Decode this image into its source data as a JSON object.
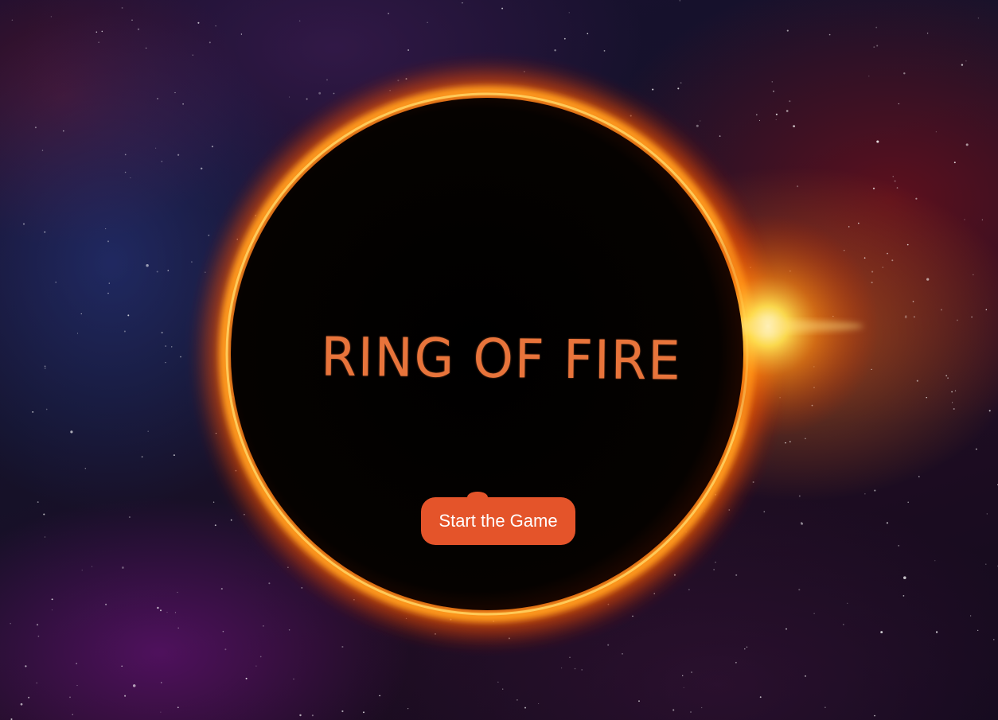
{
  "game": {
    "title": "RING OF FIRE",
    "start_label": "Start the Game"
  },
  "colors": {
    "title": "#e8743b",
    "button": "#e4542a",
    "button_text": "#ffffff",
    "ring_glow": "#ff9a1f",
    "eclipse_core": "#000000"
  },
  "icons": {
    "background": "starfield-nebula",
    "centerpiece": "solar-eclipse-ring"
  }
}
